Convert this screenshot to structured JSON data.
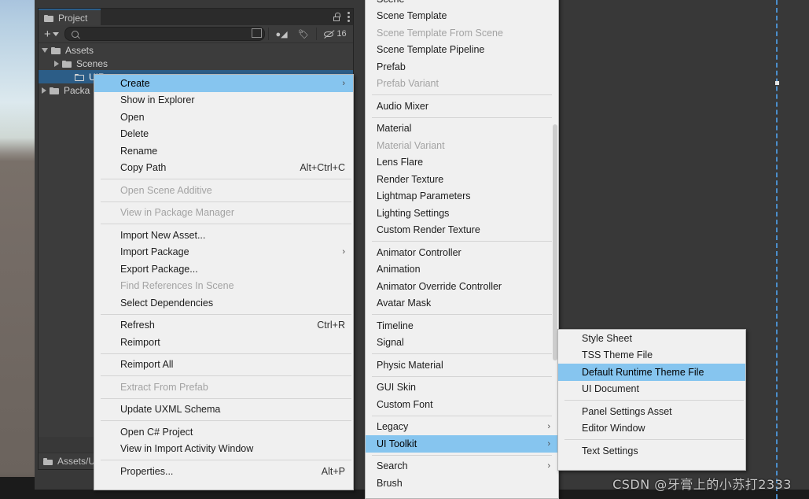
{
  "window": {
    "tab_title": "Project",
    "tab_icon": "folder-icon",
    "lock_icon": "lock-icon",
    "menu_icon": "kebab-menu-icon"
  },
  "toolbar": {
    "add_label": "+",
    "search_placeholder": "",
    "search_value": "",
    "search_icon": "search-icon",
    "save_search_icon": "save-search-icon",
    "favorite_icon": "favorite-icon",
    "label_icon": "label-icon",
    "hidden_count": "16",
    "hidden_icon": "eye-off-icon"
  },
  "project_tree": [
    {
      "label": "Assets",
      "depth": 0,
      "expanded": true,
      "selected": false,
      "has_children": true
    },
    {
      "label": "Scenes",
      "depth": 1,
      "expanded": false,
      "selected": false,
      "has_children": true
    },
    {
      "label": "UIRu",
      "depth": 2,
      "expanded": false,
      "selected": true,
      "has_children": false
    },
    {
      "label": "Packa",
      "depth": 0,
      "expanded": false,
      "selected": false,
      "has_children": true
    }
  ],
  "status_bar": {
    "path": "Assets/U",
    "icon": "folder-icon"
  },
  "context_menu": {
    "name": "asset-context-menu",
    "items": [
      {
        "label": "Create",
        "shortcut": "",
        "submenu": true,
        "disabled": false,
        "highlight": true
      },
      {
        "label": "Show in Explorer",
        "shortcut": "",
        "submenu": false,
        "disabled": false,
        "highlight": false
      },
      {
        "label": "Open",
        "shortcut": "",
        "submenu": false,
        "disabled": false,
        "highlight": false
      },
      {
        "label": "Delete",
        "shortcut": "",
        "submenu": false,
        "disabled": false,
        "highlight": false
      },
      {
        "label": "Rename",
        "shortcut": "",
        "submenu": false,
        "disabled": false,
        "highlight": false
      },
      {
        "label": "Copy Path",
        "shortcut": "Alt+Ctrl+C",
        "submenu": false,
        "disabled": false,
        "highlight": false
      },
      {
        "separator": true
      },
      {
        "label": "Open Scene Additive",
        "shortcut": "",
        "submenu": false,
        "disabled": true,
        "highlight": false
      },
      {
        "separator": true
      },
      {
        "label": "View in Package Manager",
        "shortcut": "",
        "submenu": false,
        "disabled": true,
        "highlight": false
      },
      {
        "separator": true
      },
      {
        "label": "Import New Asset...",
        "shortcut": "",
        "submenu": false,
        "disabled": false,
        "highlight": false
      },
      {
        "label": "Import Package",
        "shortcut": "",
        "submenu": true,
        "disabled": false,
        "highlight": false
      },
      {
        "label": "Export Package...",
        "shortcut": "",
        "submenu": false,
        "disabled": false,
        "highlight": false
      },
      {
        "label": "Find References In Scene",
        "shortcut": "",
        "submenu": false,
        "disabled": true,
        "highlight": false
      },
      {
        "label": "Select Dependencies",
        "shortcut": "",
        "submenu": false,
        "disabled": false,
        "highlight": false
      },
      {
        "separator": true
      },
      {
        "label": "Refresh",
        "shortcut": "Ctrl+R",
        "submenu": false,
        "disabled": false,
        "highlight": false
      },
      {
        "label": "Reimport",
        "shortcut": "",
        "submenu": false,
        "disabled": false,
        "highlight": false
      },
      {
        "separator": true
      },
      {
        "label": "Reimport All",
        "shortcut": "",
        "submenu": false,
        "disabled": false,
        "highlight": false
      },
      {
        "separator": true
      },
      {
        "label": "Extract From Prefab",
        "shortcut": "",
        "submenu": false,
        "disabled": true,
        "highlight": false
      },
      {
        "separator": true
      },
      {
        "label": "Update UXML Schema",
        "shortcut": "",
        "submenu": false,
        "disabled": false,
        "highlight": false
      },
      {
        "separator": true
      },
      {
        "label": "Open C# Project",
        "shortcut": "",
        "submenu": false,
        "disabled": false,
        "highlight": false
      },
      {
        "label": "View in Import Activity Window",
        "shortcut": "",
        "submenu": false,
        "disabled": false,
        "highlight": false
      },
      {
        "separator": true
      },
      {
        "label": "Properties...",
        "shortcut": "Alt+P",
        "submenu": false,
        "disabled": false,
        "highlight": false
      }
    ]
  },
  "create_menu": {
    "name": "create-submenu",
    "items": [
      {
        "label": "Scene",
        "submenu": false,
        "disabled": false,
        "highlight": false
      },
      {
        "label": "Scene Template",
        "submenu": false,
        "disabled": false,
        "highlight": false
      },
      {
        "label": "Scene Template From Scene",
        "submenu": false,
        "disabled": true,
        "highlight": false
      },
      {
        "label": "Scene Template Pipeline",
        "submenu": false,
        "disabled": false,
        "highlight": false
      },
      {
        "label": "Prefab",
        "submenu": false,
        "disabled": false,
        "highlight": false
      },
      {
        "label": "Prefab Variant",
        "submenu": false,
        "disabled": true,
        "highlight": false
      },
      {
        "separator": true
      },
      {
        "label": "Audio Mixer",
        "submenu": false,
        "disabled": false,
        "highlight": false
      },
      {
        "separator": true
      },
      {
        "label": "Material",
        "submenu": false,
        "disabled": false,
        "highlight": false
      },
      {
        "label": "Material Variant",
        "submenu": false,
        "disabled": true,
        "highlight": false
      },
      {
        "label": "Lens Flare",
        "submenu": false,
        "disabled": false,
        "highlight": false
      },
      {
        "label": "Render Texture",
        "submenu": false,
        "disabled": false,
        "highlight": false
      },
      {
        "label": "Lightmap Parameters",
        "submenu": false,
        "disabled": false,
        "highlight": false
      },
      {
        "label": "Lighting Settings",
        "submenu": false,
        "disabled": false,
        "highlight": false
      },
      {
        "label": "Custom Render Texture",
        "submenu": false,
        "disabled": false,
        "highlight": false
      },
      {
        "separator": true
      },
      {
        "label": "Animator Controller",
        "submenu": false,
        "disabled": false,
        "highlight": false
      },
      {
        "label": "Animation",
        "submenu": false,
        "disabled": false,
        "highlight": false
      },
      {
        "label": "Animator Override Controller",
        "submenu": false,
        "disabled": false,
        "highlight": false
      },
      {
        "label": "Avatar Mask",
        "submenu": false,
        "disabled": false,
        "highlight": false
      },
      {
        "separator": true
      },
      {
        "label": "Timeline",
        "submenu": false,
        "disabled": false,
        "highlight": false
      },
      {
        "label": "Signal",
        "submenu": false,
        "disabled": false,
        "highlight": false
      },
      {
        "separator": true
      },
      {
        "label": "Physic Material",
        "submenu": false,
        "disabled": false,
        "highlight": false
      },
      {
        "separator": true
      },
      {
        "label": "GUI Skin",
        "submenu": false,
        "disabled": false,
        "highlight": false
      },
      {
        "label": "Custom Font",
        "submenu": false,
        "disabled": false,
        "highlight": false
      },
      {
        "separator": true
      },
      {
        "label": "Legacy",
        "submenu": true,
        "disabled": false,
        "highlight": false
      },
      {
        "label": "UI Toolkit",
        "submenu": true,
        "disabled": false,
        "highlight": true
      },
      {
        "separator": true
      },
      {
        "label": "Search",
        "submenu": true,
        "disabled": false,
        "highlight": false
      },
      {
        "label": "Brush",
        "submenu": false,
        "disabled": false,
        "highlight": false
      }
    ]
  },
  "ui_toolkit_menu": {
    "name": "ui-toolkit-submenu",
    "items": [
      {
        "label": "Style Sheet",
        "submenu": false,
        "disabled": false,
        "highlight": false
      },
      {
        "label": "TSS Theme File",
        "submenu": false,
        "disabled": false,
        "highlight": false
      },
      {
        "label": "Default Runtime Theme File",
        "submenu": false,
        "disabled": false,
        "highlight": true
      },
      {
        "label": "UI Document",
        "submenu": false,
        "disabled": false,
        "highlight": false
      },
      {
        "separator": true
      },
      {
        "label": "Panel Settings Asset",
        "submenu": false,
        "disabled": false,
        "highlight": false
      },
      {
        "label": "Editor Window",
        "submenu": false,
        "disabled": false,
        "highlight": false
      },
      {
        "separator": true
      },
      {
        "label": "Text Settings",
        "submenu": false,
        "disabled": false,
        "highlight": false
      }
    ]
  },
  "watermark": {
    "text": "CSDN @牙膏上的小苏打2333"
  },
  "colors": {
    "highlight": "#86c5ef",
    "menu_bg": "#f0f0f0",
    "editor_bg": "#383838",
    "panel_bg": "#3c3c3c",
    "selection": "#2c5d87",
    "marker": "#4b8ecb"
  }
}
